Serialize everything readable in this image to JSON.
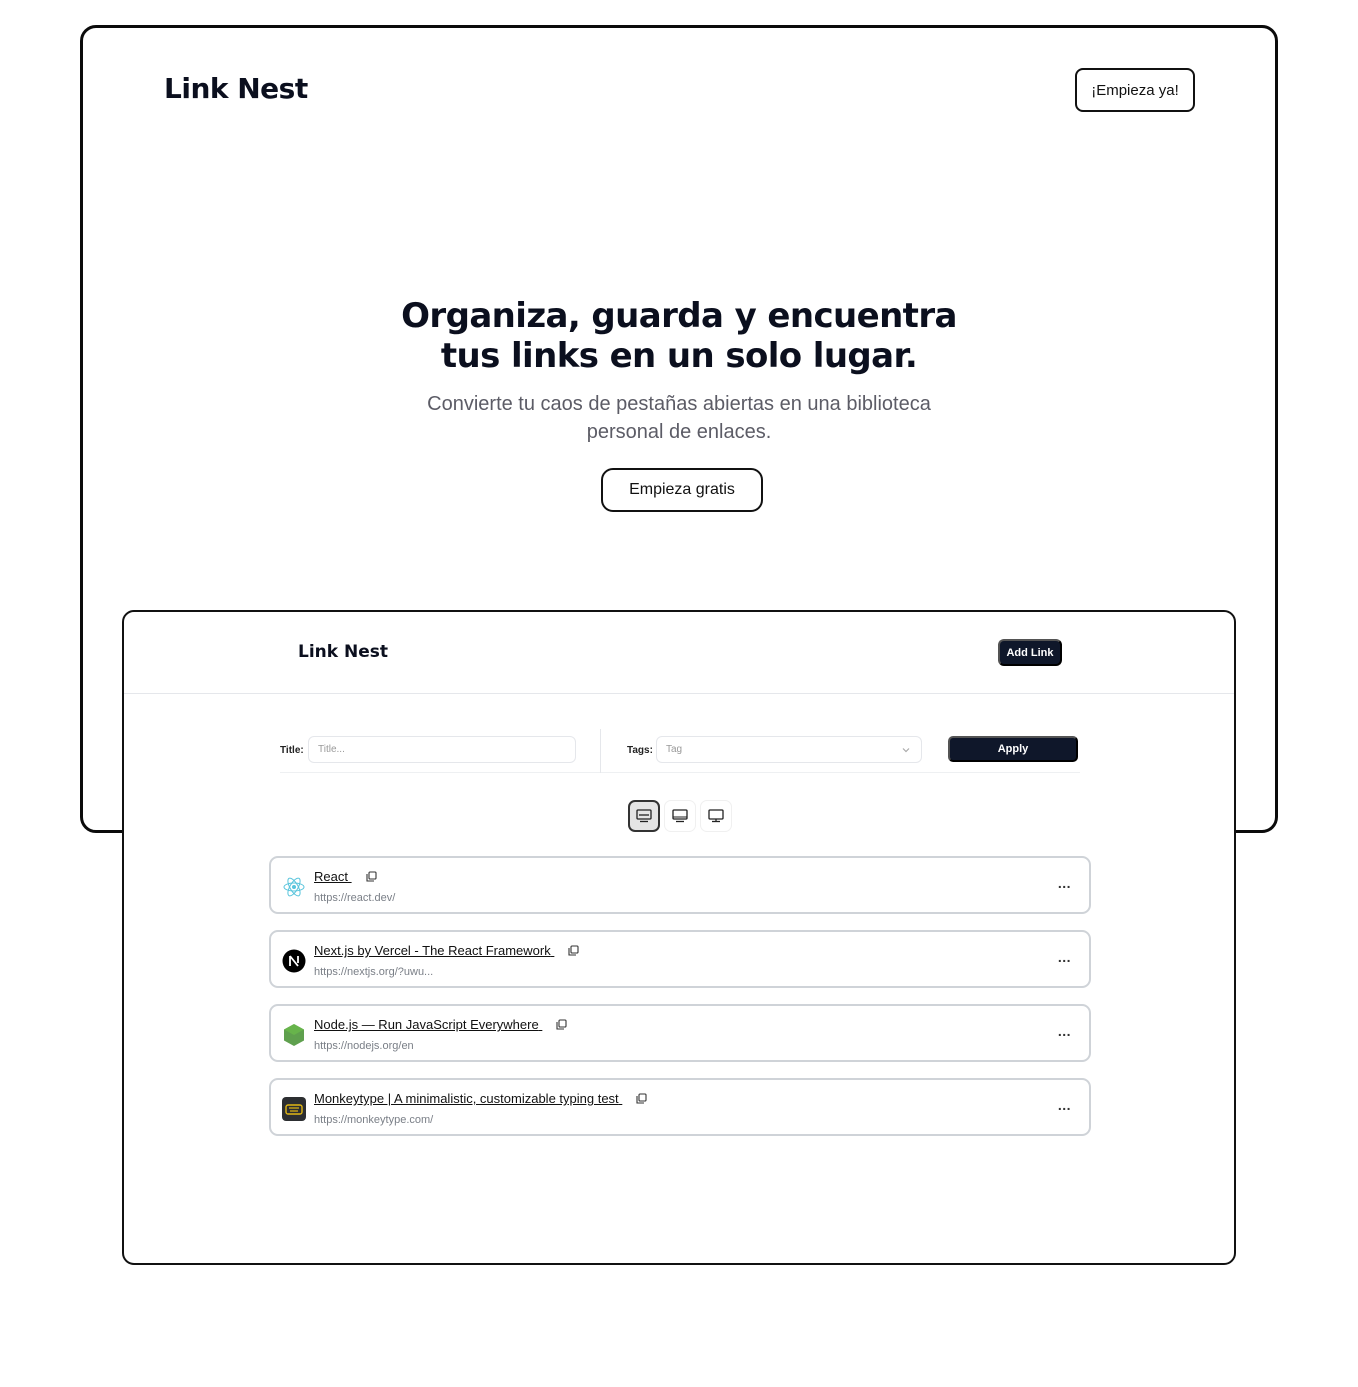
{
  "hero": {
    "logo": "Link Nest",
    "top_cta": "¡Empieza ya!",
    "title_line1": "Organiza, guarda y encuentra",
    "title_line2": "tus links en un solo lugar.",
    "subtitle_line1": "Convierte tu caos de pestañas abiertas en una biblioteca",
    "subtitle_line2": "personal de enlaces.",
    "cta": "Empieza gratis"
  },
  "app": {
    "logo": "Link Nest",
    "add_link": "Add Link",
    "filters": {
      "title_label": "Title:",
      "title_placeholder": "Title...",
      "tags_label": "Tags:",
      "tags_placeholder": "Tag",
      "apply": "Apply"
    },
    "view_modes": [
      {
        "icon": "list-view-icon",
        "active": true
      },
      {
        "icon": "grid-view-icon",
        "active": false
      },
      {
        "icon": "card-view-icon",
        "active": false
      }
    ],
    "links": [
      {
        "title": "React",
        "url": "https://react.dev/",
        "icon": "react-icon",
        "color": "#58c4dc"
      },
      {
        "title": "Next.js by Vercel - The React Framework",
        "url": "https://nextjs.org/?uwu...",
        "icon": "nextjs-icon",
        "color": "#000000"
      },
      {
        "title": "Node.js — Run JavaScript Everywhere",
        "url": "https://nodejs.org/en",
        "icon": "nodejs-icon",
        "color": "#5fa04e"
      },
      {
        "title": "Monkeytype | A minimalistic, customizable typing test",
        "url": "https://monkeytype.com/",
        "icon": "monkeytype-icon",
        "color": "#e2b714"
      }
    ],
    "more_label": "..."
  }
}
